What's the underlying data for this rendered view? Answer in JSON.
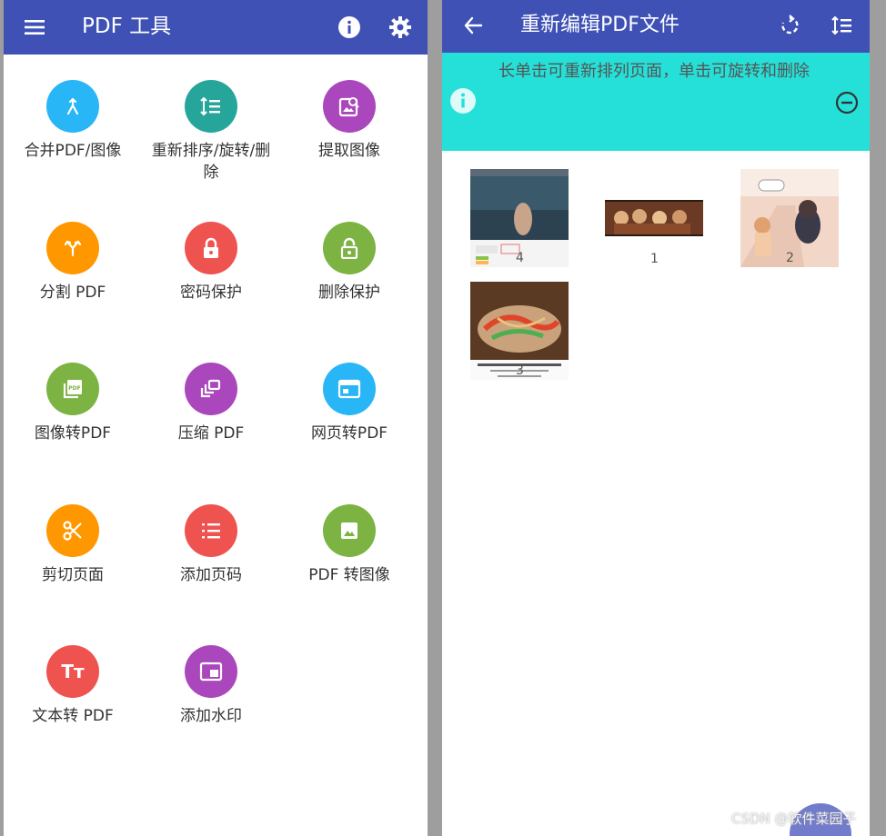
{
  "left_app": {
    "title": "PDF 工具",
    "tools": [
      {
        "label": "合并PDF/图像",
        "color": "#29b6f6",
        "icon": "merge-icon"
      },
      {
        "label": "重新排序/旋转/删除",
        "color": "#26a69a",
        "icon": "reorder-list-icon"
      },
      {
        "label": "提取图像",
        "color": "#ab47bc",
        "icon": "extract-image-icon"
      },
      {
        "label": "分割 PDF",
        "color": "#ff9800",
        "icon": "split-icon"
      },
      {
        "label": "密码保护",
        "color": "#ef5350",
        "icon": "lock-icon"
      },
      {
        "label": "删除保护",
        "color": "#7cb342",
        "icon": "unlock-icon"
      },
      {
        "label": "图像转PDF",
        "color": "#7cb342",
        "icon": "pdf-file-icon"
      },
      {
        "label": "压缩 PDF",
        "color": "#ab47bc",
        "icon": "compress-icon"
      },
      {
        "label": "网页转PDF",
        "color": "#29b6f6",
        "icon": "webpage-icon"
      },
      {
        "label": "剪切页面",
        "color": "#ff9800",
        "icon": "scissors-icon"
      },
      {
        "label": "添加页码",
        "color": "#ef5350",
        "icon": "numbered-list-icon"
      },
      {
        "label": "PDF 转图像",
        "color": "#7cb342",
        "icon": "image-icon"
      },
      {
        "label": "文本转 PDF",
        "color": "#ef5350",
        "icon": "text-icon"
      },
      {
        "label": "添加水印",
        "color": "#ab47bc",
        "icon": "watermark-icon"
      }
    ],
    "text_icon_glyph": "Tт"
  },
  "right_app": {
    "title": "重新编辑PDF文件",
    "info_text": "长单击可重新排列页面，单击可旋转和删除",
    "pages": [
      {
        "number": "4"
      },
      {
        "number": "1"
      },
      {
        "number": "2"
      },
      {
        "number": "3"
      }
    ]
  },
  "watermark": "CSDN @软件菜园子",
  "colors": {
    "app_bar": "#3f51b5",
    "info_banner": "#25e0d8"
  }
}
